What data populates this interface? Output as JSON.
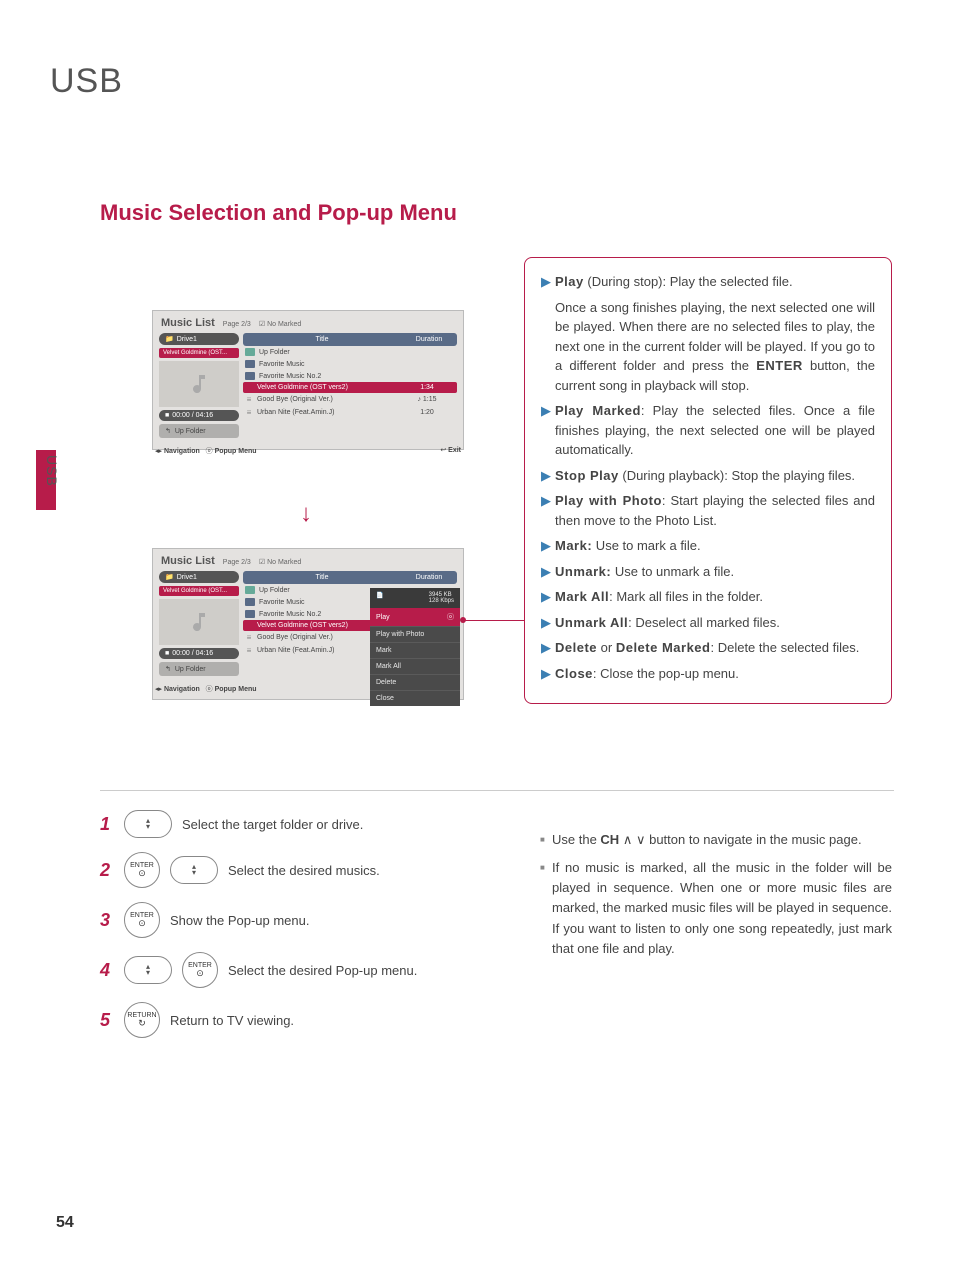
{
  "page": {
    "title": "USB",
    "section": "Music Selection and Pop-up Menu",
    "sidebar": "USB",
    "number": "54"
  },
  "shot": {
    "heading": "Music List",
    "page_label": "Page 2/3",
    "marked_label": "No Marked",
    "drive": "Drive1",
    "drive_selected": "Velvet Goldmine (OST...",
    "time": "00:00 / 04:16",
    "up_folder_btn": "Up Folder",
    "cols": {
      "title": "Title",
      "duration": "Duration"
    },
    "rows": {
      "up": "Up Folder",
      "r1": "Favorite Music",
      "r2": "Favorite Music No.2",
      "r3": "Velvet Goldmine (OST vers2)",
      "d3": "1:34",
      "r4": "Good Bye (Original Ver.)",
      "d4": "1:15",
      "r5": "Urban Nite (Feat.Amin.J)",
      "d5": "1:20"
    },
    "footer": {
      "nav": "Navigation",
      "popup": "Popup Menu",
      "exit": "Exit"
    }
  },
  "popup": {
    "file_size": "3945 KB",
    "bitrate": "128 Kbps",
    "items": {
      "play": "Play",
      "pwp": "Play with Photo",
      "mark": "Mark",
      "markall": "Mark All",
      "delete": "Delete",
      "close": "Close"
    }
  },
  "info": {
    "play": {
      "lead": "Play",
      "suffix": " (During stop): Play the selected file.",
      "body": "Once a song finishes playing, the next selected one will be played. When there are no selected files to play, the next one in the current folder will be played. If you go to a different folder and press the ",
      "enter": "ENTER",
      "body2": " button, the current song in playback will stop."
    },
    "play_marked": {
      "lead": "Play Marked",
      "body": ": Play the selected files. Once a file finishes playing, the next selected one will be played automatically."
    },
    "stop_play": {
      "lead": "Stop Play",
      "body": " (During playback): Stop the playing files."
    },
    "pwp": {
      "lead": "Play with Photo",
      "body": ": Start playing the selected files and then move to the Photo List."
    },
    "mark": {
      "lead": "Mark:",
      "body": " Use to mark a file."
    },
    "unmark": {
      "lead": "Unmark:",
      "body": " Use to unmark a file."
    },
    "markall": {
      "lead": "Mark All",
      "body": ": Mark all files in the folder."
    },
    "unmarkall": {
      "lead": "Unmark All",
      "body": ": Deselect all marked files."
    },
    "delete": {
      "lead": "Delete",
      "mid": " or ",
      "lead2": "Delete Marked",
      "body": ": Delete the selected files."
    },
    "close": {
      "lead": "Close",
      "body": ": Close the pop-up menu."
    }
  },
  "steps": {
    "s1": "Select the target folder or drive.",
    "s2": "Select the desired musics.",
    "s3": "Show the Pop-up menu.",
    "s4": "Select the desired Pop-up menu.",
    "s5": "Return to TV viewing.",
    "enter": "ENTER",
    "return": "RETURN"
  },
  "notes": {
    "n1a": "Use the ",
    "n1b": "CH",
    "n1c": "  button to navigate in the music page.",
    "n2": "If no music is marked, all the music in the folder will be played in sequence. When one or more music files are marked, the marked music files will be played in sequence. If you want to listen to only one song repeatedly, just mark that one file and play."
  }
}
